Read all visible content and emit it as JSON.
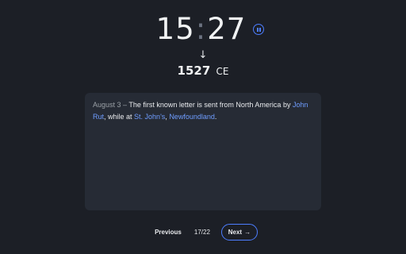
{
  "clock": {
    "hours": "15",
    "separator": ":",
    "minutes": "27"
  },
  "arrow_glyph": "↓",
  "year": {
    "value": "1527",
    "era": "CE"
  },
  "event": {
    "date": "August 3",
    "dash": " – ",
    "text_1": "The first known letter is sent from North America by ",
    "link_person": "John Rut",
    "text_2": ", while at ",
    "link_place": "St. John's",
    "text_3": ", ",
    "link_region": "Newfoundland",
    "text_4": "."
  },
  "navigation": {
    "previous_label": "Previous",
    "counter": "17/22",
    "next_label": "Next",
    "next_arrow": "→"
  },
  "colors": {
    "background": "#1c1f26",
    "card": "#262b35",
    "accent": "#4c7dff",
    "link": "#6f9dff"
  }
}
